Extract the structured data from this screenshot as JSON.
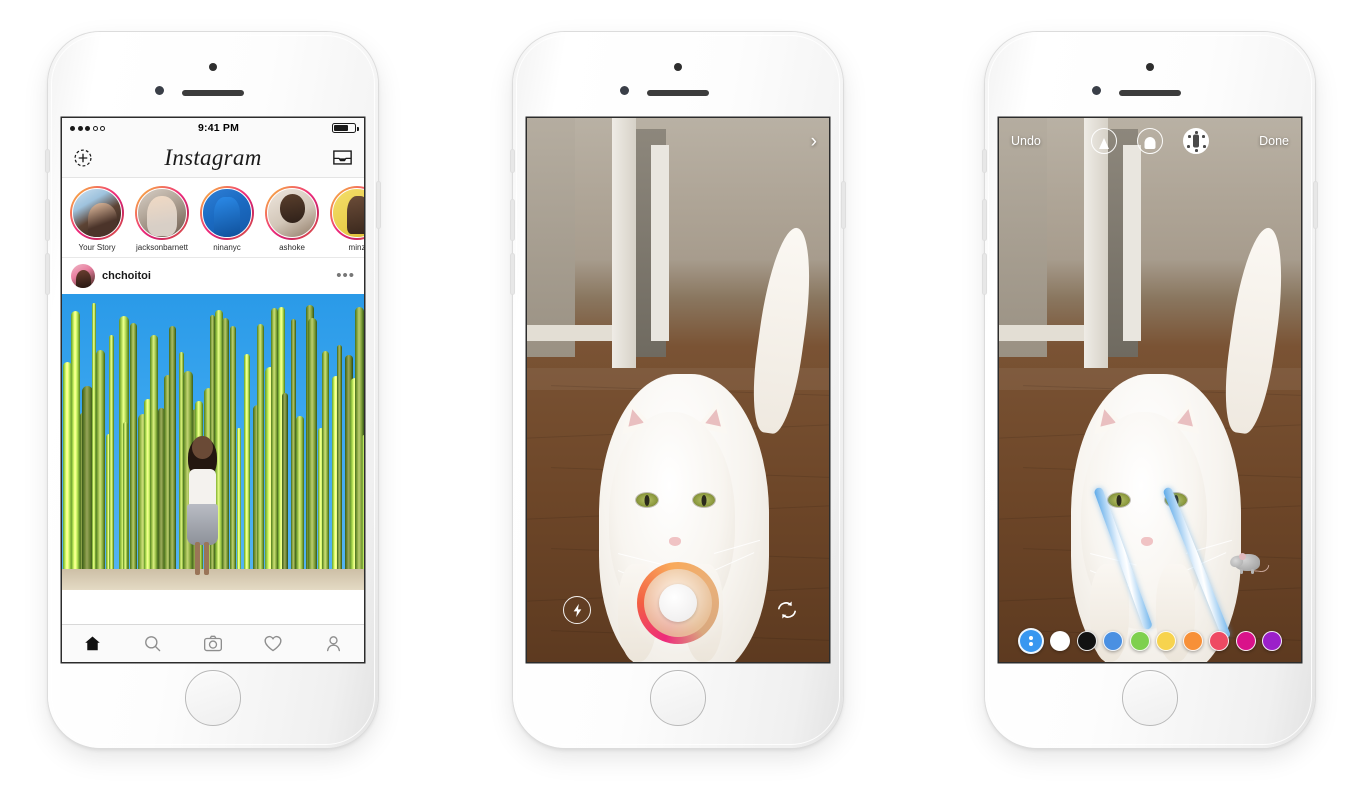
{
  "page": {
    "title": "Instagram Stories announcement — three iPhone screens"
  },
  "phone1": {
    "name": "instagram-feed",
    "status_bar": {
      "time": "9:41 PM",
      "signal_dots_filled": 3,
      "signal_dots_total": 5,
      "battery_percent": 72
    },
    "nav": {
      "logo": "Instagram",
      "left_icon": "add-photo-icon",
      "right_icon": "direct-inbox-icon"
    },
    "stories": [
      {
        "label": "Your Story",
        "avatar": "av1"
      },
      {
        "label": "jacksonbarnett",
        "avatar": "av2"
      },
      {
        "label": "ninanyc",
        "avatar": "av3"
      },
      {
        "label": "ashoke",
        "avatar": "av4"
      },
      {
        "label": "minz",
        "avatar": "av5"
      }
    ],
    "post": {
      "username": "chchoitoi",
      "more_label": "•••",
      "image_alt": "woman standing in front of tall cactus garden under blue sky"
    },
    "tabbar": [
      {
        "name": "home",
        "icon": "home-icon",
        "active": true
      },
      {
        "name": "search",
        "icon": "search-icon",
        "active": false
      },
      {
        "name": "camera",
        "icon": "camera-icon",
        "active": false
      },
      {
        "name": "activity",
        "icon": "heart-icon",
        "active": false
      },
      {
        "name": "profile",
        "icon": "person-icon",
        "active": false
      }
    ]
  },
  "phone2": {
    "name": "story-camera",
    "image_alt": "white cat with green eyes standing on wooden floor in a hallway",
    "chevron": "›",
    "controls": {
      "flash_icon": "flash-icon",
      "shutter": "shutter-button",
      "flip_icon": "camera-flip-icon"
    }
  },
  "phone3": {
    "name": "story-draw-mode",
    "image_alt": "same white cat with blue laser strokes drawn from its eyes and a mouse sticker",
    "top_bar": {
      "undo_label": "Undo",
      "done_label": "Done",
      "tools": [
        {
          "name": "pen-tool",
          "icon": "pen-thin-icon",
          "selected": false
        },
        {
          "name": "marker-tool",
          "icon": "pen-marker-icon",
          "selected": false
        },
        {
          "name": "glitter-tool",
          "icon": "pen-glitter-icon",
          "selected": true
        }
      ]
    },
    "colors": [
      {
        "name": "color-picker",
        "hex": "#3897f0",
        "selected": true
      },
      {
        "name": "white",
        "hex": "#ffffff",
        "selected": false
      },
      {
        "name": "black",
        "hex": "#121212",
        "selected": false
      },
      {
        "name": "blue",
        "hex": "#4a90e2",
        "selected": false
      },
      {
        "name": "green",
        "hex": "#7ed04f",
        "selected": false
      },
      {
        "name": "yellow",
        "hex": "#f7d34e",
        "selected": false
      },
      {
        "name": "orange",
        "hex": "#f79038",
        "selected": false
      },
      {
        "name": "red",
        "hex": "#ee4a63",
        "selected": false
      },
      {
        "name": "magenta",
        "hex": "#d9128a",
        "selected": false
      },
      {
        "name": "purple",
        "hex": "#9b20c9",
        "selected": false
      }
    ],
    "sticker": "mouse-sticker",
    "stroke_color": "#5aa8e8"
  }
}
